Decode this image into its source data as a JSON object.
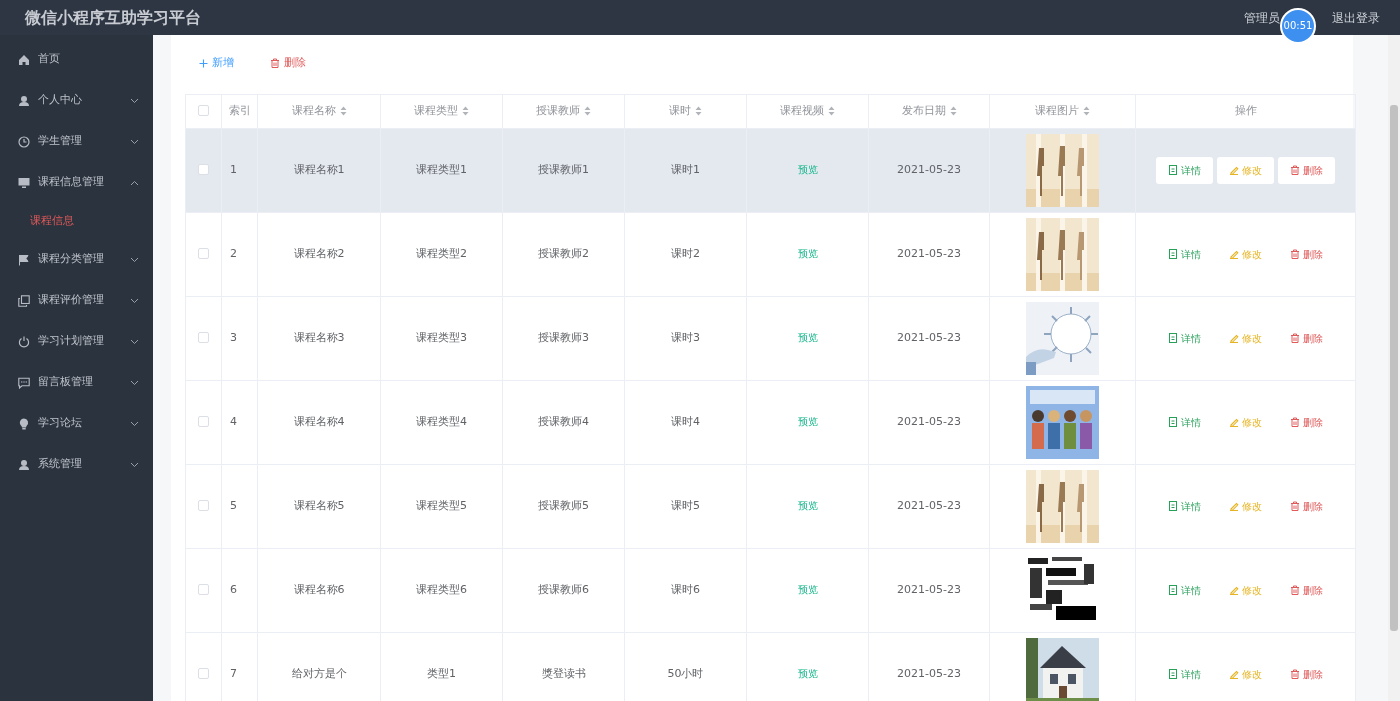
{
  "header": {
    "title": "微信小程序互助学习平台",
    "user": "管理员",
    "timer": "00:51",
    "logout": "退出登录"
  },
  "sidebar": {
    "items": [
      {
        "label": "首页"
      },
      {
        "label": "个人中心",
        "expanded": false
      },
      {
        "label": "学生管理",
        "expanded": false
      },
      {
        "label": "课程信息管理",
        "expanded": true,
        "children": [
          {
            "label": "课程信息",
            "selected": true
          }
        ]
      },
      {
        "label": "课程分类管理",
        "expanded": false
      },
      {
        "label": "课程评价管理",
        "expanded": false
      },
      {
        "label": "学习计划管理",
        "expanded": false
      },
      {
        "label": "留言板管理",
        "expanded": false
      },
      {
        "label": "学习论坛",
        "expanded": false
      },
      {
        "label": "系统管理",
        "expanded": false
      }
    ]
  },
  "toolbar": {
    "add": "新增",
    "delete": "删除"
  },
  "table": {
    "all_checked": false,
    "columns": [
      {
        "label": "索引",
        "sortable": false
      },
      {
        "label": "课程名称",
        "sortable": true
      },
      {
        "label": "课程类型",
        "sortable": true
      },
      {
        "label": "授课教师",
        "sortable": true
      },
      {
        "label": "课时",
        "sortable": true
      },
      {
        "label": "课程视频",
        "sortable": true
      },
      {
        "label": "发布日期",
        "sortable": true
      },
      {
        "label": "课程图片",
        "sortable": true
      },
      {
        "label": "操作",
        "sortable": false
      }
    ],
    "rows": [
      {
        "index": "1",
        "name": "课程名称1",
        "type": "课程类型1",
        "teacher": "授课教师1",
        "hours": "课时1",
        "video": "预览",
        "date": "2021-05-23",
        "checked": false,
        "hovered": true,
        "actions": [
          "详情",
          "修改",
          "删除"
        ]
      },
      {
        "index": "2",
        "name": "课程名称2",
        "type": "课程类型2",
        "teacher": "授课教师2",
        "hours": "课时2",
        "video": "预览",
        "date": "2021-05-23",
        "checked": false,
        "hovered": false,
        "actions": [
          "详情",
          "修改",
          "删除"
        ]
      },
      {
        "index": "3",
        "name": "课程名称3",
        "type": "课程类型3",
        "teacher": "授课教师3",
        "hours": "课时3",
        "video": "预览",
        "date": "2021-05-23",
        "checked": false,
        "hovered": false,
        "actions": [
          "详情",
          "修改",
          "删除"
        ]
      },
      {
        "index": "4",
        "name": "课程名称4",
        "type": "课程类型4",
        "teacher": "授课教师4",
        "hours": "课时4",
        "video": "预览",
        "date": "2021-05-23",
        "checked": false,
        "hovered": false,
        "actions": [
          "详情",
          "修改",
          "删除"
        ]
      },
      {
        "index": "5",
        "name": "课程名称5",
        "type": "课程类型5",
        "teacher": "授课教师5",
        "hours": "课时5",
        "video": "预览",
        "date": "2021-05-23",
        "checked": false,
        "hovered": false,
        "actions": [
          "详情",
          "修改",
          "删除"
        ]
      },
      {
        "index": "6",
        "name": "课程名称6",
        "type": "课程类型6",
        "teacher": "授课教师6",
        "hours": "课时6",
        "video": "预览",
        "date": "2021-05-23",
        "checked": false,
        "hovered": false,
        "actions": [
          "详情",
          "修改",
          "删除"
        ]
      },
      {
        "index": "7",
        "name": "给对方是个",
        "type": "类型1",
        "teacher": "獎登读书",
        "hours": "50小时",
        "video": "预览",
        "date": "2021-05-23",
        "checked": false,
        "hovered": false,
        "actions": [
          "详情",
          "修改",
          "删除"
        ]
      }
    ]
  }
}
